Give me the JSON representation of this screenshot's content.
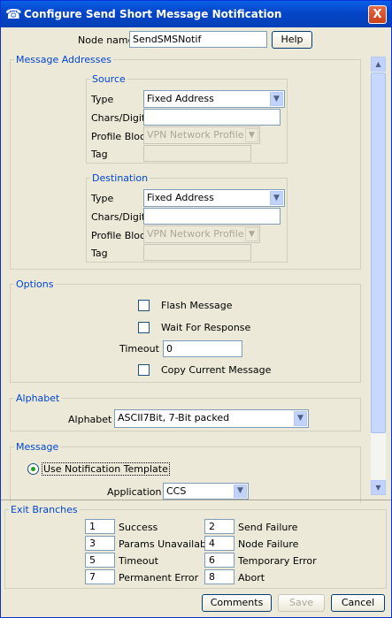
{
  "window": {
    "title": "Configure Send Short Message Notification",
    "close_glyph": "X"
  },
  "node": {
    "label": "Node name",
    "value": "SendSMSNotif",
    "help_label": "Help"
  },
  "message_addresses": {
    "legend": "Message Addresses",
    "source": {
      "legend": "Source",
      "type_label": "Type",
      "type_value": "Fixed Address",
      "chars_label": "Chars/Digits",
      "chars_value": "",
      "profile_label": "Profile Block",
      "profile_value": "VPN Network Profile",
      "tag_label": "Tag",
      "tag_value": ""
    },
    "destination": {
      "legend": "Destination",
      "type_label": "Type",
      "type_value": "Fixed Address",
      "chars_label": "Chars/Digits",
      "chars_value": "",
      "profile_label": "Profile Block",
      "profile_value": "VPN Network Profile",
      "tag_label": "Tag",
      "tag_value": ""
    }
  },
  "options": {
    "legend": "Options",
    "flash_label": "Flash Message",
    "wait_label": "Wait For Response",
    "timeout_label": "Timeout",
    "timeout_value": "0",
    "copy_label": "Copy Current Message"
  },
  "alphabet": {
    "legend": "Alphabet",
    "label": "Alphabet",
    "value": "ASCII7Bit, 7-Bit packed"
  },
  "message": {
    "legend": "Message",
    "use_template_label": "Use Notification Template",
    "application_label": "Application",
    "application_value": "CCS"
  },
  "exit_branches": {
    "legend": "Exit Branches",
    "items": [
      {
        "num": "1",
        "label": "Success"
      },
      {
        "num": "2",
        "label": "Send Failure"
      },
      {
        "num": "3",
        "label": "Params Unavailable"
      },
      {
        "num": "4",
        "label": "Node Failure"
      },
      {
        "num": "5",
        "label": "Timeout"
      },
      {
        "num": "6",
        "label": "Temporary Error"
      },
      {
        "num": "7",
        "label": "Permanent Error"
      },
      {
        "num": "8",
        "label": "Abort"
      }
    ]
  },
  "buttons": {
    "comments": "Comments",
    "save": "Save",
    "cancel": "Cancel"
  },
  "icons": {
    "title": "phone-icon",
    "dropdown": "chevron-down-icon",
    "scroll_up": "scroll-up-icon",
    "scroll_down": "scroll-down-icon"
  }
}
